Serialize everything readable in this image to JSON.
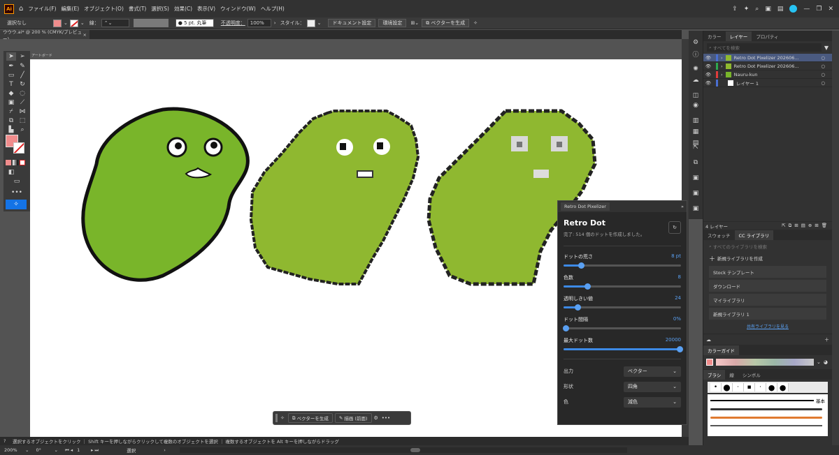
{
  "menu": {
    "logo": "Ai",
    "items": [
      "ファイル(F)",
      "編集(E)",
      "オブジェクト(O)",
      "書式(T)",
      "選択(S)",
      "効果(C)",
      "表示(V)",
      "ウィンドウ(W)",
      "ヘルプ(H)"
    ]
  },
  "control": {
    "selection": "選択なし",
    "stroke_label": "線：",
    "stroke_weight": "5 pt. 丸筆",
    "opacity_label": "不透明度：",
    "opacity": "100%",
    "style_label": "スタイル：",
    "doc_settings": "ドキュメント設定",
    "preferences": "環境設定",
    "vectorize": "ベクターを生成"
  },
  "tab": {
    "title": "ウウウ.ai* @ 200 % (CMYK/プレビュー)",
    "close": "×"
  },
  "artboard_label": "アートボード",
  "status": {
    "hint": "選択するオブジェクトをクリック ｜ Shift キーを押しながらクリックして複数のオブジェクトを選択 ｜ 複数するオブジェクトを Alt キーを押しながらドラッグ",
    "zoom": "200%",
    "rotation": "0°",
    "page": "1",
    "tool": "選択"
  },
  "context_bar": {
    "vectorize": "ベクターを生成",
    "draw": "描画 (前面)"
  },
  "plugin": {
    "tab": "Retro Dot Pixelizer",
    "title": "Retro Dot",
    "status": "完了: 514 個のドットを作成しました。",
    "sliders": [
      {
        "label": "ドットの荒さ",
        "value": "8 pt",
        "fraction": 0.15
      },
      {
        "label": "色数",
        "value": "8",
        "fraction": 0.2
      },
      {
        "label": "透明しきい値",
        "value": "24",
        "fraction": 0.12
      },
      {
        "label": "ドット間隔",
        "value": "0%",
        "fraction": 0.0
      },
      {
        "label": "最大ドット数",
        "value": "20000",
        "fraction": 1.0
      }
    ],
    "selects": [
      {
        "label": "出力",
        "value": "ベクター"
      },
      {
        "label": "形状",
        "value": "四角"
      },
      {
        "label": "色",
        "value": "減色"
      }
    ]
  },
  "panels": {
    "top_tabs": [
      "カラー",
      "レイヤー",
      "プロパティ"
    ],
    "search_placeholder": "すべてを検索",
    "layers": [
      {
        "name": "Retro Dot Pixelizer 202606...",
        "color": "#4a6fd1"
      },
      {
        "name": "Retro Dot Pixelizer 202606...",
        "color": "#2fa84f"
      },
      {
        "name": "Nauru-kun",
        "color": "#e03c3c"
      },
      {
        "name": "レイヤー 1",
        "color": "#4a6fd1"
      }
    ],
    "layer_count": "4 レイヤー",
    "lib_tabs": [
      "スウォッチ",
      "CC ライブラリ"
    ],
    "lib_search": "すべてのライブラリを検索",
    "new_library": "新規ライブラリを作成",
    "libraries": [
      "Stock テンプレート",
      "ダウンロード",
      "マイライブラリ",
      "新規ライブラリ 1"
    ],
    "shared_link": "共有ライブラリを見る",
    "color_guide": "カラーガイド",
    "brush_tabs": [
      "ブラシ",
      "線",
      "シンボル"
    ],
    "brush_basic": "基本"
  },
  "colors": {
    "fill": "#f08c8c",
    "blob": "#79b52a",
    "pixel_blob": "#8fb830",
    "accent": "#1473e6"
  }
}
